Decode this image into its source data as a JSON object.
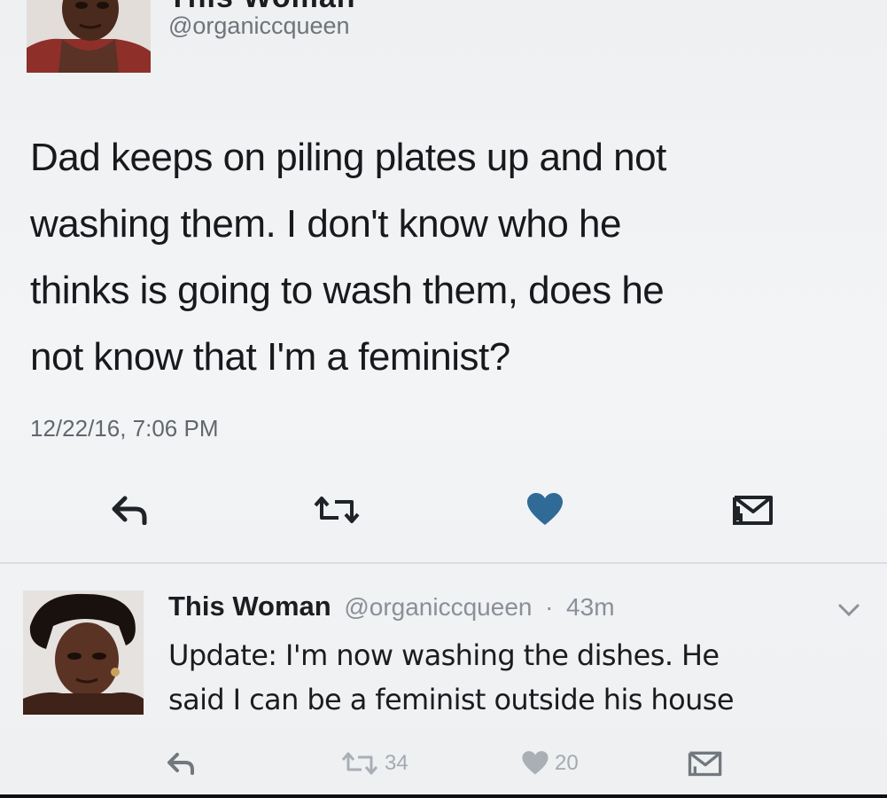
{
  "top_tweet": {
    "display_name": "This Woman",
    "handle": "@organiccqueen",
    "text": "Dad keeps on piling plates up and not\nwashing them. I don't  know who he\nthinks is going to wash them, does he\nnot know that I'm a feminist?",
    "timestamp": "12/22/16, 7:06 PM",
    "actions": {
      "reply_icon": "reply-arrow-icon",
      "retweet_icon": "retweet-icon",
      "like_icon": "heart-icon",
      "dm_icon": "direct-message-icon"
    },
    "accent_heart_color": "#2f6b96"
  },
  "reply_tweet": {
    "display_name": "This Woman",
    "handle": "@organiccqueen",
    "separator": "·",
    "age": "43m",
    "text": "Update: I'm now washing the dishes. He\nsaid I can be a feminist outside his house",
    "retweet_count": "34",
    "like_count": "20"
  }
}
